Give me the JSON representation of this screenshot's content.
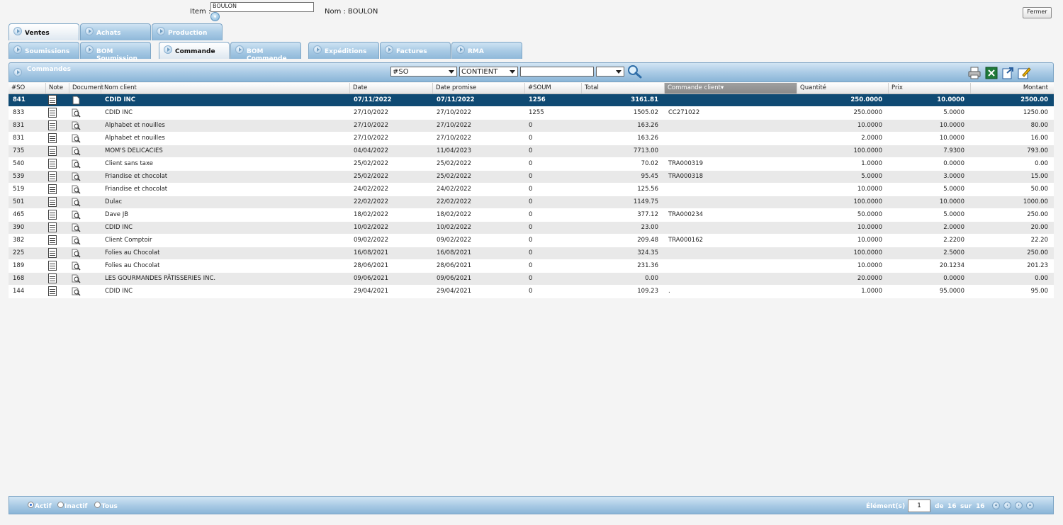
{
  "header": {
    "item_label": "Item :",
    "item_value": "BOULON",
    "nom_label": "Nom :",
    "nom_value": "BOULON",
    "close_label": "Fermer"
  },
  "tabs_row1": [
    {
      "label": "Ventes",
      "active": true
    },
    {
      "label": "Achats",
      "active": false
    },
    {
      "label": "Production",
      "active": false
    }
  ],
  "tabs_row2": [
    {
      "label": "Soumissions",
      "active": false
    },
    {
      "label": "BOM Soumission",
      "active": false
    },
    {
      "label": "Commande",
      "active": true
    },
    {
      "label": "BOM Commande",
      "active": false
    },
    {
      "label": "Expéditions",
      "active": false
    },
    {
      "label": "Factures",
      "active": false
    },
    {
      "label": "RMA",
      "active": false
    }
  ],
  "toolbar": {
    "title": "Commandes",
    "field_select": "#SO",
    "operator_select": "CONTIENT",
    "search_value": "",
    "extra_select": ""
  },
  "table": {
    "headers": [
      "#SO",
      "Note",
      "Document",
      "Nom client",
      "Date",
      "Date promise",
      "#SOUM",
      "Total",
      "Commande client",
      "Quantité",
      "Prix",
      "Montant"
    ],
    "rows": [
      {
        "so": "841",
        "client": "CDID INC",
        "date": "07/11/2022",
        "promise": "07/11/2022",
        "soum": "1256",
        "total": "3161.81",
        "cmd": "",
        "qty": "250.0000",
        "prix": "10.0000",
        "montant": "2500.00"
      },
      {
        "so": "833",
        "client": "CDID INC",
        "date": "27/10/2022",
        "promise": "27/10/2022",
        "soum": "1255",
        "total": "1505.02",
        "cmd": "CC271022",
        "qty": "250.0000",
        "prix": "5.0000",
        "montant": "1250.00"
      },
      {
        "so": "831",
        "client": "Alphabet et nouilles",
        "date": "27/10/2022",
        "promise": "27/10/2022",
        "soum": "0",
        "total": "163.26",
        "cmd": "",
        "qty": "10.0000",
        "prix": "10.0000",
        "montant": "80.00"
      },
      {
        "so": "831",
        "client": "Alphabet et nouilles",
        "date": "27/10/2022",
        "promise": "27/10/2022",
        "soum": "0",
        "total": "163.26",
        "cmd": "",
        "qty": "2.0000",
        "prix": "10.0000",
        "montant": "16.00"
      },
      {
        "so": "735",
        "client": "MOM'S DELICACIES",
        "date": "04/04/2022",
        "promise": "11/04/2023",
        "soum": "0",
        "total": "7713.00",
        "cmd": "",
        "qty": "100.0000",
        "prix": "7.9300",
        "montant": "793.00"
      },
      {
        "so": "540",
        "client": "Client sans taxe",
        "date": "25/02/2022",
        "promise": "25/02/2022",
        "soum": "0",
        "total": "70.02",
        "cmd": "TRA000319",
        "qty": "1.0000",
        "prix": "0.0000",
        "montant": "0.00"
      },
      {
        "so": "539",
        "client": "Friandise et chocolat",
        "date": "25/02/2022",
        "promise": "25/02/2022",
        "soum": "0",
        "total": "95.45",
        "cmd": "TRA000318",
        "qty": "5.0000",
        "prix": "3.0000",
        "montant": "15.00"
      },
      {
        "so": "519",
        "client": "Friandise et chocolat",
        "date": "24/02/2022",
        "promise": "24/02/2022",
        "soum": "0",
        "total": "125.56",
        "cmd": "",
        "qty": "10.0000",
        "prix": "5.0000",
        "montant": "50.00"
      },
      {
        "so": "501",
        "client": "Dulac",
        "date": "22/02/2022",
        "promise": "22/02/2022",
        "soum": "0",
        "total": "1149.75",
        "cmd": "",
        "qty": "100.0000",
        "prix": "10.0000",
        "montant": "1000.00"
      },
      {
        "so": "465",
        "client": "Dave JB",
        "date": "18/02/2022",
        "promise": "18/02/2022",
        "soum": "0",
        "total": "377.12",
        "cmd": "TRA000234",
        "qty": "50.0000",
        "prix": "5.0000",
        "montant": "250.00"
      },
      {
        "so": "390",
        "client": "CDID INC",
        "date": "10/02/2022",
        "promise": "10/02/2022",
        "soum": "0",
        "total": "23.00",
        "cmd": "",
        "qty": "10.0000",
        "prix": "2.0000",
        "montant": "20.00"
      },
      {
        "so": "382",
        "client": "Client Comptoir",
        "date": "09/02/2022",
        "promise": "09/02/2022",
        "soum": "0",
        "total": "209.48",
        "cmd": "TRA000162",
        "qty": "10.0000",
        "prix": "2.2200",
        "montant": "22.20"
      },
      {
        "so": "225",
        "client": "Folies au Chocolat",
        "date": "16/08/2021",
        "promise": "16/08/2021",
        "soum": "0",
        "total": "324.35",
        "cmd": "",
        "qty": "100.0000",
        "prix": "2.5000",
        "montant": "250.00"
      },
      {
        "so": "189",
        "client": "Folies au Chocolat",
        "date": "28/06/2021",
        "promise": "28/06/2021",
        "soum": "0",
        "total": "231.36",
        "cmd": "",
        "qty": "10.0000",
        "prix": "20.1234",
        "montant": "201.23"
      },
      {
        "so": "168",
        "client": "LES GOURMANDES PÂTISSERIES INC.",
        "date": "09/06/2021",
        "promise": "09/06/2021",
        "soum": "0",
        "total": "0.00",
        "cmd": "",
        "qty": "20.0000",
        "prix": "0.0000",
        "montant": "0.00"
      },
      {
        "so": "144",
        "client": "CDID INC",
        "date": "29/04/2021",
        "promise": "29/04/2021",
        "soum": "0",
        "total": "109.23",
        "cmd": ".",
        "qty": "1.0000",
        "prix": "95.0000",
        "montant": "95.00"
      }
    ]
  },
  "footer": {
    "radio_actif": "Actif",
    "radio_inactif": "Inactif",
    "radio_tous": "Tous",
    "elements_label": "Élément(s)",
    "page_value": "1",
    "of_label": "de",
    "range_end": "16",
    "sur_label": "sur",
    "total": "16"
  },
  "colors": {
    "selected_row": "#0f4a73",
    "tab_blue": "#a9cbe5",
    "toolbar_blue": "#8ab5d7"
  }
}
